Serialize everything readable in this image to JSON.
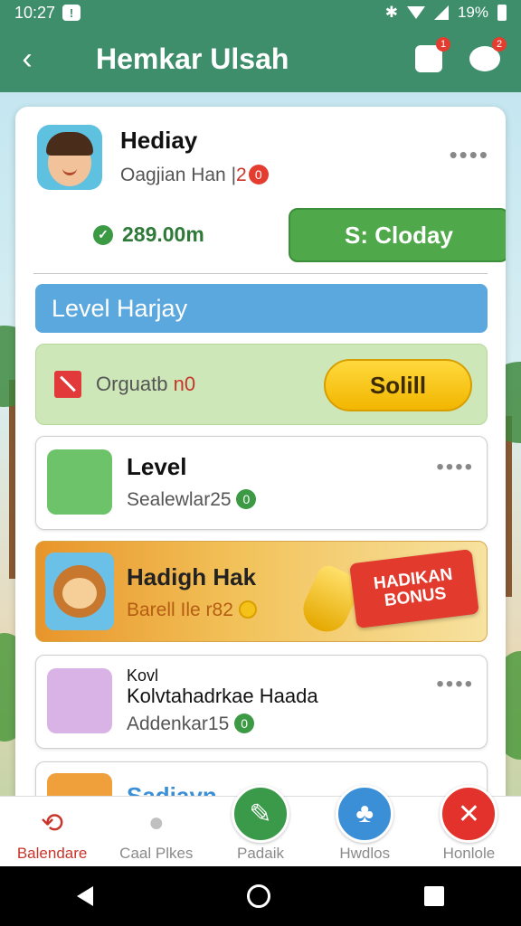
{
  "status_bar": {
    "time": "10:27",
    "battery": "19%"
  },
  "header": {
    "title": "Hemkar Ulsah",
    "compose_badge": "1",
    "chat_badge": "2"
  },
  "profile": {
    "name": "Hediay",
    "subtitle": "Oagjian Han |",
    "subtitle_badge": "2",
    "subtitle_badge_num": "0",
    "balance": "289.00m",
    "cta_label": "S: Cloday",
    "more": "••••"
  },
  "section": {
    "title": "Level Harjay"
  },
  "quest": {
    "text": "Orguatb",
    "text_highlight": "n0",
    "button_label": "Solill"
  },
  "items": [
    {
      "title": "Level",
      "subtitle": "Sealewlar25",
      "badge": "0",
      "more": "••••"
    },
    {
      "title": "Kovl",
      "title2": "Kolvtahadrkae Haada",
      "subtitle": "Addenkar15",
      "badge": "0",
      "more": "••••"
    },
    {
      "title": "Sadiayn"
    }
  ],
  "promo": {
    "title": "Hadigh Hak",
    "subtitle": "Barell Ile r82",
    "tag_line1": "HADIKAN",
    "tag_line2": "BONUS"
  },
  "bottom_nav": [
    {
      "label": "Balendare",
      "icon": "refresh-icon"
    },
    {
      "label": "Caal Plkes",
      "icon": "apple-icon"
    },
    {
      "label": "Padaik",
      "icon": "leaf-icon"
    },
    {
      "label": "Hwdlos",
      "icon": "tree-icon"
    },
    {
      "label": "Honlole",
      "icon": "close-icon"
    }
  ],
  "colors": {
    "header": "#3e8e6b",
    "cta_green": "#4fa84a",
    "section_blue": "#5aa8dd",
    "quest_bg": "#cde7b8",
    "yellow_button": "#f2b600",
    "badge_red": "#e43d2f",
    "nav_green": "#3a9a4a",
    "nav_blue": "#3b8fd6",
    "nav_red": "#e2322b"
  }
}
